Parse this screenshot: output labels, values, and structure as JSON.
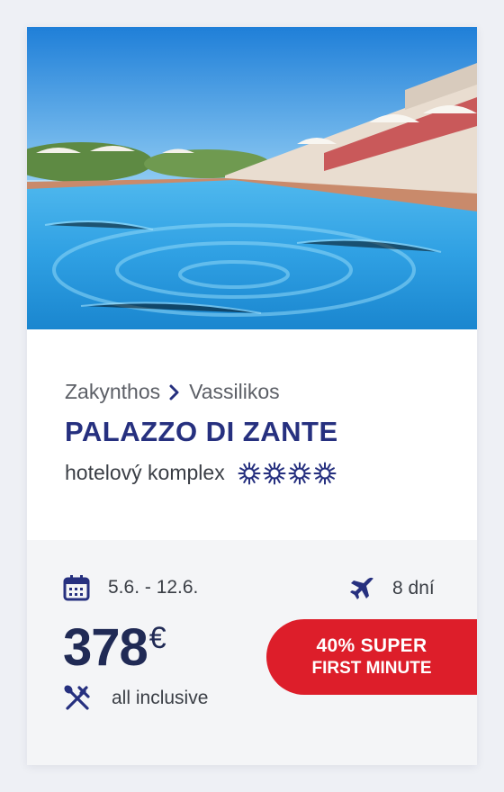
{
  "hotel": {
    "photo_alt": "hotel-pool-photo",
    "breadcrumb": {
      "region": "Zakynthos",
      "locality": "Vassilikos"
    },
    "name": "PALAZZO DI ZANTE",
    "type": "hotelový komplex",
    "stars": 4
  },
  "trip": {
    "dates": "5.6. - 12.6.",
    "duration": "8 dní",
    "price_value": "378",
    "price_currency": "€",
    "board": "all inclusive"
  },
  "promo": {
    "line1": "40% SUPER",
    "line2": "FIRST MINUTE"
  },
  "colors": {
    "title": "#26307f",
    "promo": "#dd1e2a",
    "price": "#202a55"
  }
}
